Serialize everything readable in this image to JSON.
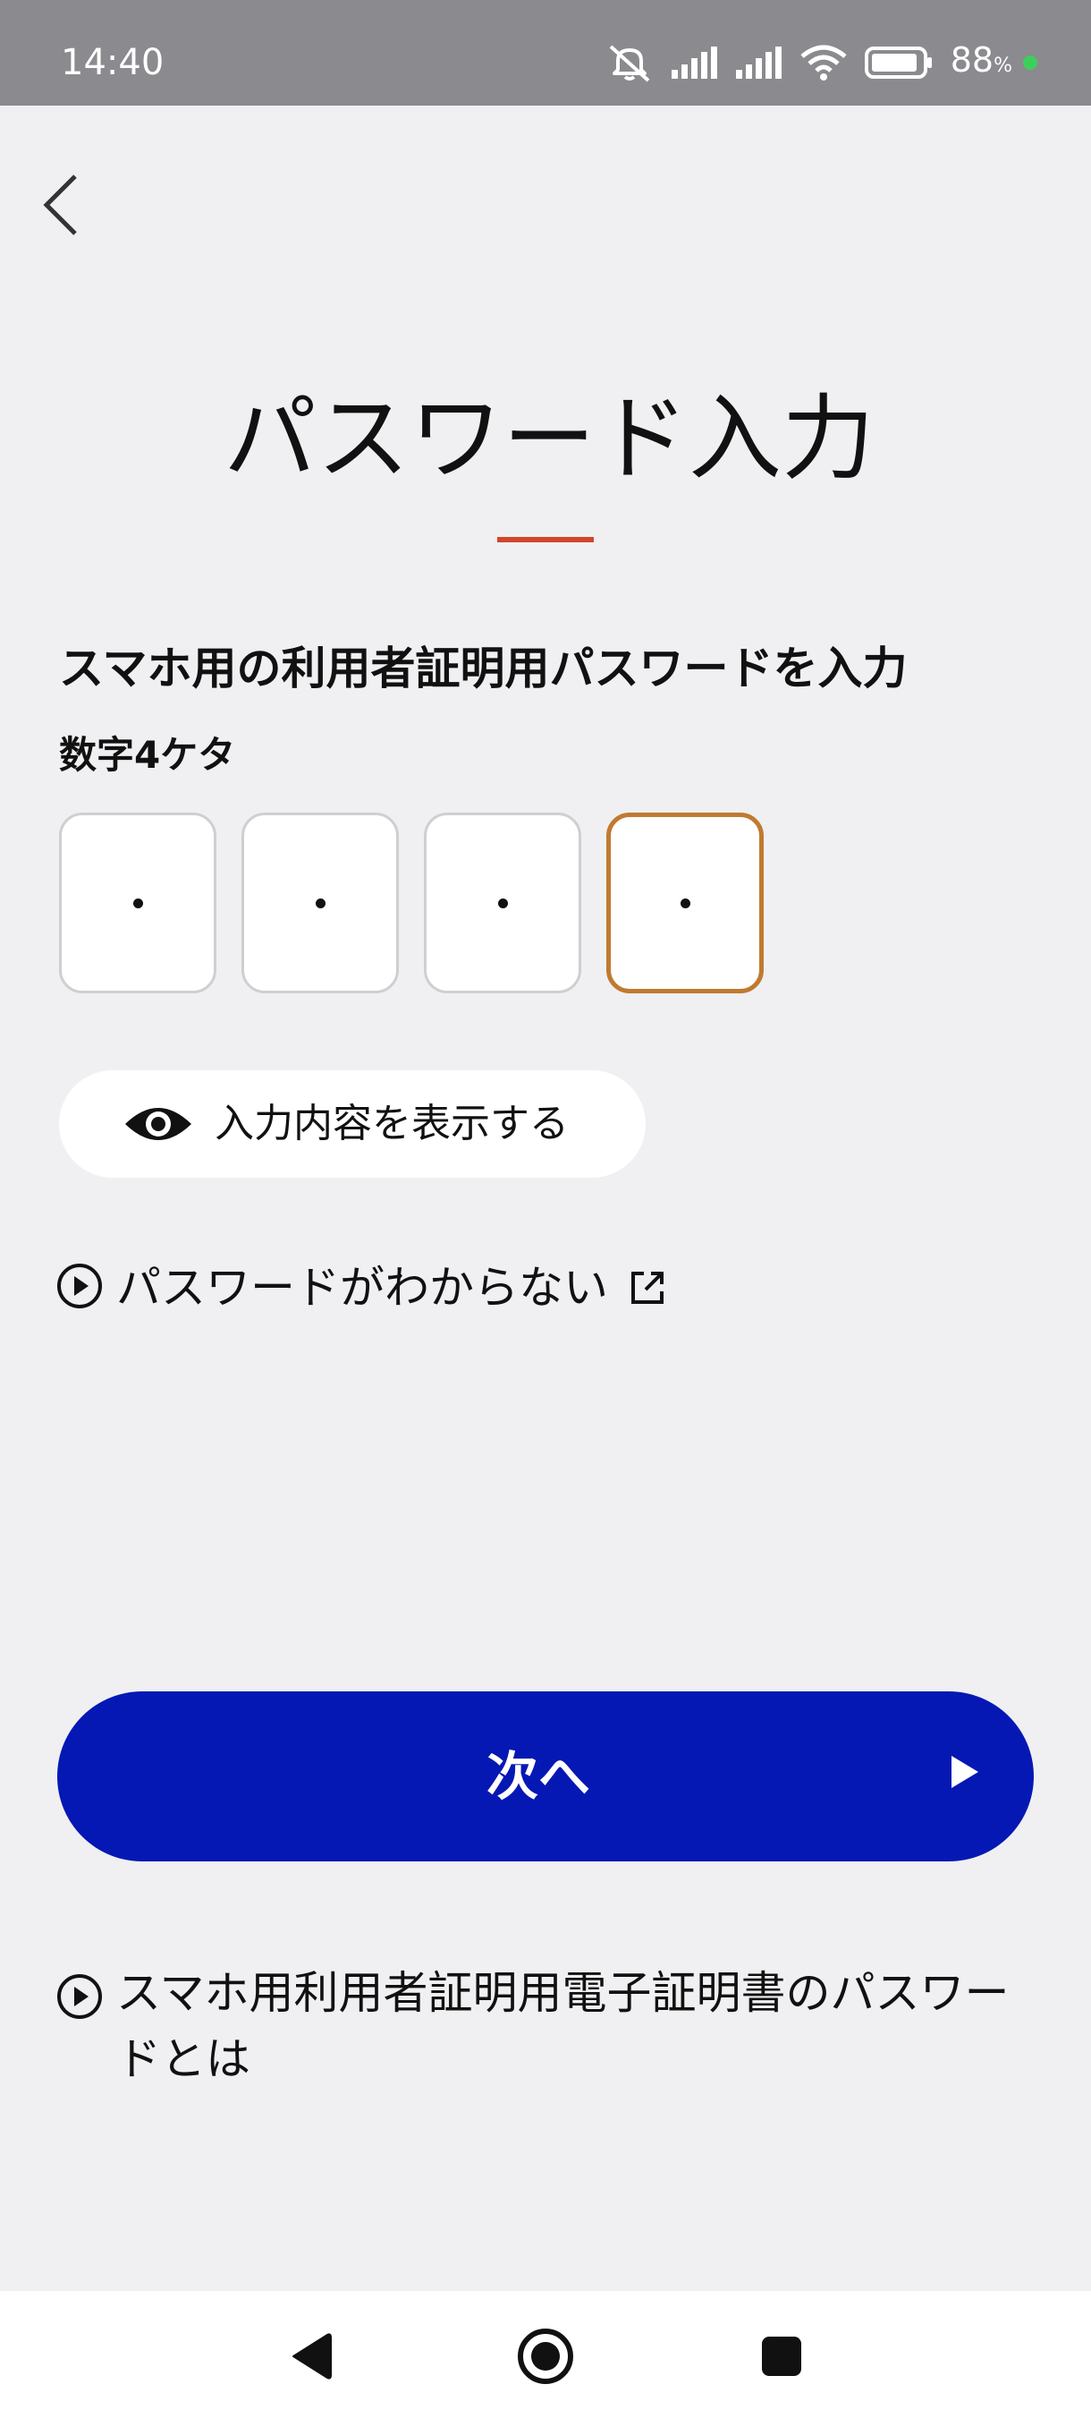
{
  "status_bar": {
    "time": "14:40",
    "battery_percent": "88",
    "battery_unit": "%",
    "icons": [
      "mute-icon",
      "signal-icon",
      "signal-icon",
      "wifi-icon",
      "battery-icon"
    ]
  },
  "header": {
    "back_icon": "chevron-left-icon"
  },
  "title": "パスワード入力",
  "accent_color": "#d2462a",
  "form": {
    "heading": "スマホ用の利用者証明用パスワードを入力",
    "subheading": "数字4ケタ",
    "pin_length": 4,
    "pin_filled": 4,
    "active_box_color": "#c07a30"
  },
  "show_toggle": {
    "icon": "eye-icon",
    "label": "入力内容を表示する"
  },
  "forgot_link": {
    "icon": "play-circle-icon",
    "label": "パスワードがわからない",
    "trailing_icon": "external-link-icon"
  },
  "next_button": {
    "label": "次へ",
    "icon": "play-arrow-icon",
    "color": "#0518b4"
  },
  "about_link": {
    "icon": "play-circle-icon",
    "label": "スマホ用利用者証明用電子証明書のパスワードとは"
  },
  "nav_bar": {
    "back_icon": "nav-back-icon",
    "home_icon": "nav-home-icon",
    "recent_icon": "nav-recent-icon"
  }
}
